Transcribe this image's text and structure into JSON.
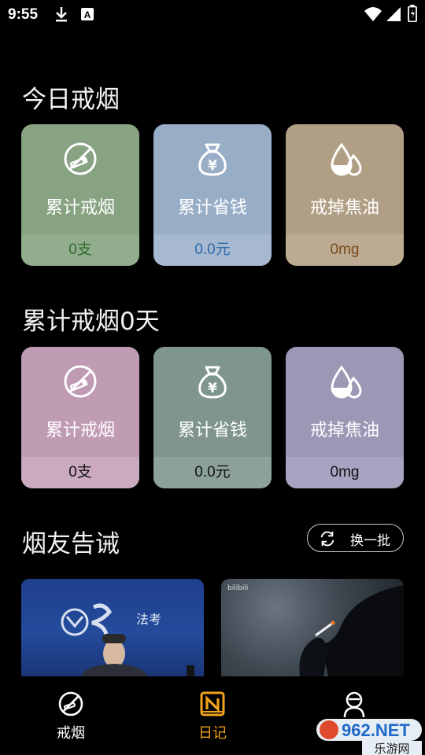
{
  "status_bar": {
    "time": "9:55",
    "left_icons": [
      "download-icon",
      "a-notification-icon"
    ],
    "right_icons": [
      "wifi-icon",
      "signal-icon",
      "battery-icon"
    ]
  },
  "today": {
    "title": "今日戒烟",
    "cards": [
      {
        "label": "累计戒烟",
        "value": "0支",
        "icon": "no-smoking-icon",
        "bg": "#87a382",
        "foot_bg": "#92ad8d",
        "value_color": "#2e6a2a"
      },
      {
        "label": "累计省钱",
        "value": "0.0元",
        "icon": "money-bag-icon",
        "bg": "#98adc6",
        "foot_bg": "#a6b9d0",
        "value_color": "#2f6aa8"
      },
      {
        "label": "戒掉焦油",
        "value": "0mg",
        "icon": "tar-drops-icon",
        "bg": "#b19f85",
        "foot_bg": "#bcab92",
        "value_color": "#7a4b1a"
      }
    ]
  },
  "total": {
    "title": "累计戒烟0天",
    "cards": [
      {
        "label": "累计戒烟",
        "value": "0支",
        "icon": "no-smoking-icon",
        "bg": "#c09bb4",
        "foot_bg": "#cba9c0",
        "value_color": "#111111"
      },
      {
        "label": "累计省钱",
        "value": "0.0元",
        "icon": "money-bag-icon",
        "bg": "#7f958e",
        "foot_bg": "#8ca19a",
        "value_color": "#111111"
      },
      {
        "label": "戒掉焦油",
        "value": "0mg",
        "icon": "tar-drops-icon",
        "bg": "#9b97b5",
        "foot_bg": "#a7a3c0",
        "value_color": "#111111"
      }
    ]
  },
  "warnings": {
    "title": "烟友告诫",
    "refresh_label": "换一批",
    "videos": [
      {
        "overlay_text": "法考"
      },
      {
        "overlay_text": "bilibili"
      }
    ]
  },
  "tabbar": {
    "tabs": [
      {
        "label": "戒烟",
        "icon": "no-smoking-icon",
        "active": false
      },
      {
        "label": "日记",
        "icon": "diary-icon",
        "active": true
      },
      {
        "label": "",
        "icon": "profile-icon",
        "active": false
      }
    ],
    "active_color": "#f0a21a"
  },
  "watermark": {
    "text_top": "962.NET",
    "text_bottom": "乐游网"
  }
}
